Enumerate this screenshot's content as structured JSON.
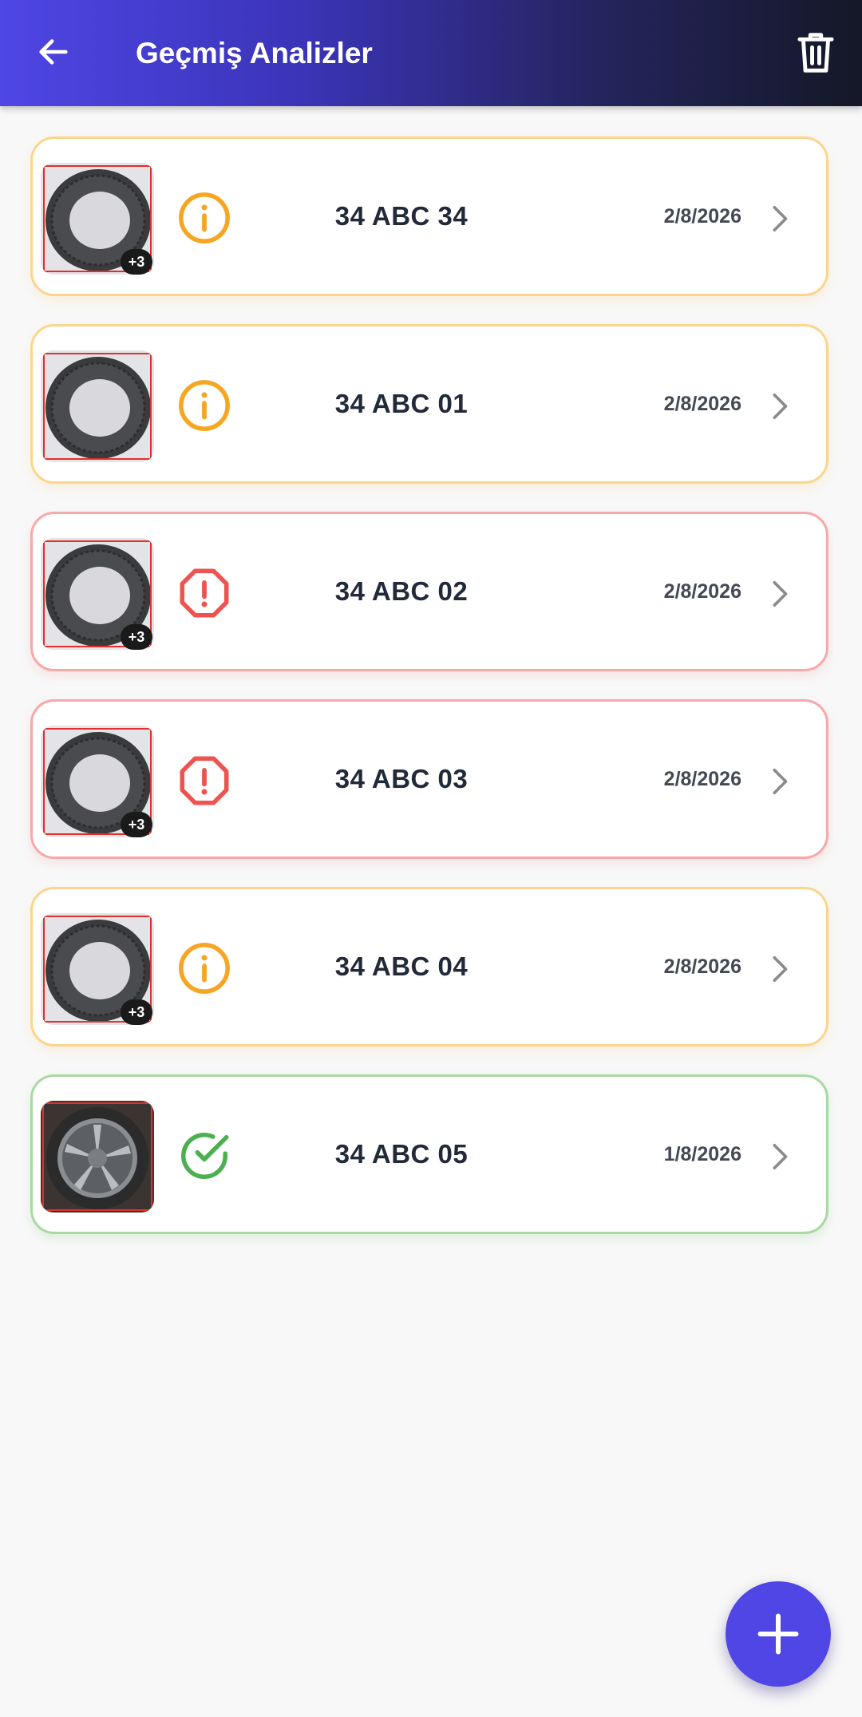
{
  "header": {
    "title": "Geçmiş Analizler",
    "back_icon": "arrow-left-icon",
    "delete_icon": "trash-icon"
  },
  "colors": {
    "primary": "#4f46e5",
    "warning": "#f5a623",
    "error": "#ef5350",
    "success": "#4caf50"
  },
  "analyses": [
    {
      "plate": "34 ABC 34",
      "date": "2/8/2026",
      "status": "warning",
      "status_icon": "info-circle-icon",
      "extra_count": "+3",
      "image": "tire"
    },
    {
      "plate": "34 ABC 01",
      "date": "2/8/2026",
      "status": "warning",
      "status_icon": "info-circle-icon",
      "extra_count": "",
      "image": "tire"
    },
    {
      "plate": "34 ABC 02",
      "date": "2/8/2026",
      "status": "error",
      "status_icon": "alert-octagon-icon",
      "extra_count": "+3",
      "image": "tire"
    },
    {
      "plate": "34 ABC 03",
      "date": "2/8/2026",
      "status": "error",
      "status_icon": "alert-octagon-icon",
      "extra_count": "+3",
      "image": "tire"
    },
    {
      "plate": "34 ABC 04",
      "date": "2/8/2026",
      "status": "warning",
      "status_icon": "info-circle-icon",
      "extra_count": "+3",
      "image": "tire"
    },
    {
      "plate": "34 ABC 05",
      "date": "1/8/2026",
      "status": "success",
      "status_icon": "check-circle-icon",
      "extra_count": "",
      "image": "wheel"
    }
  ],
  "fab": {
    "icon": "plus-icon"
  }
}
